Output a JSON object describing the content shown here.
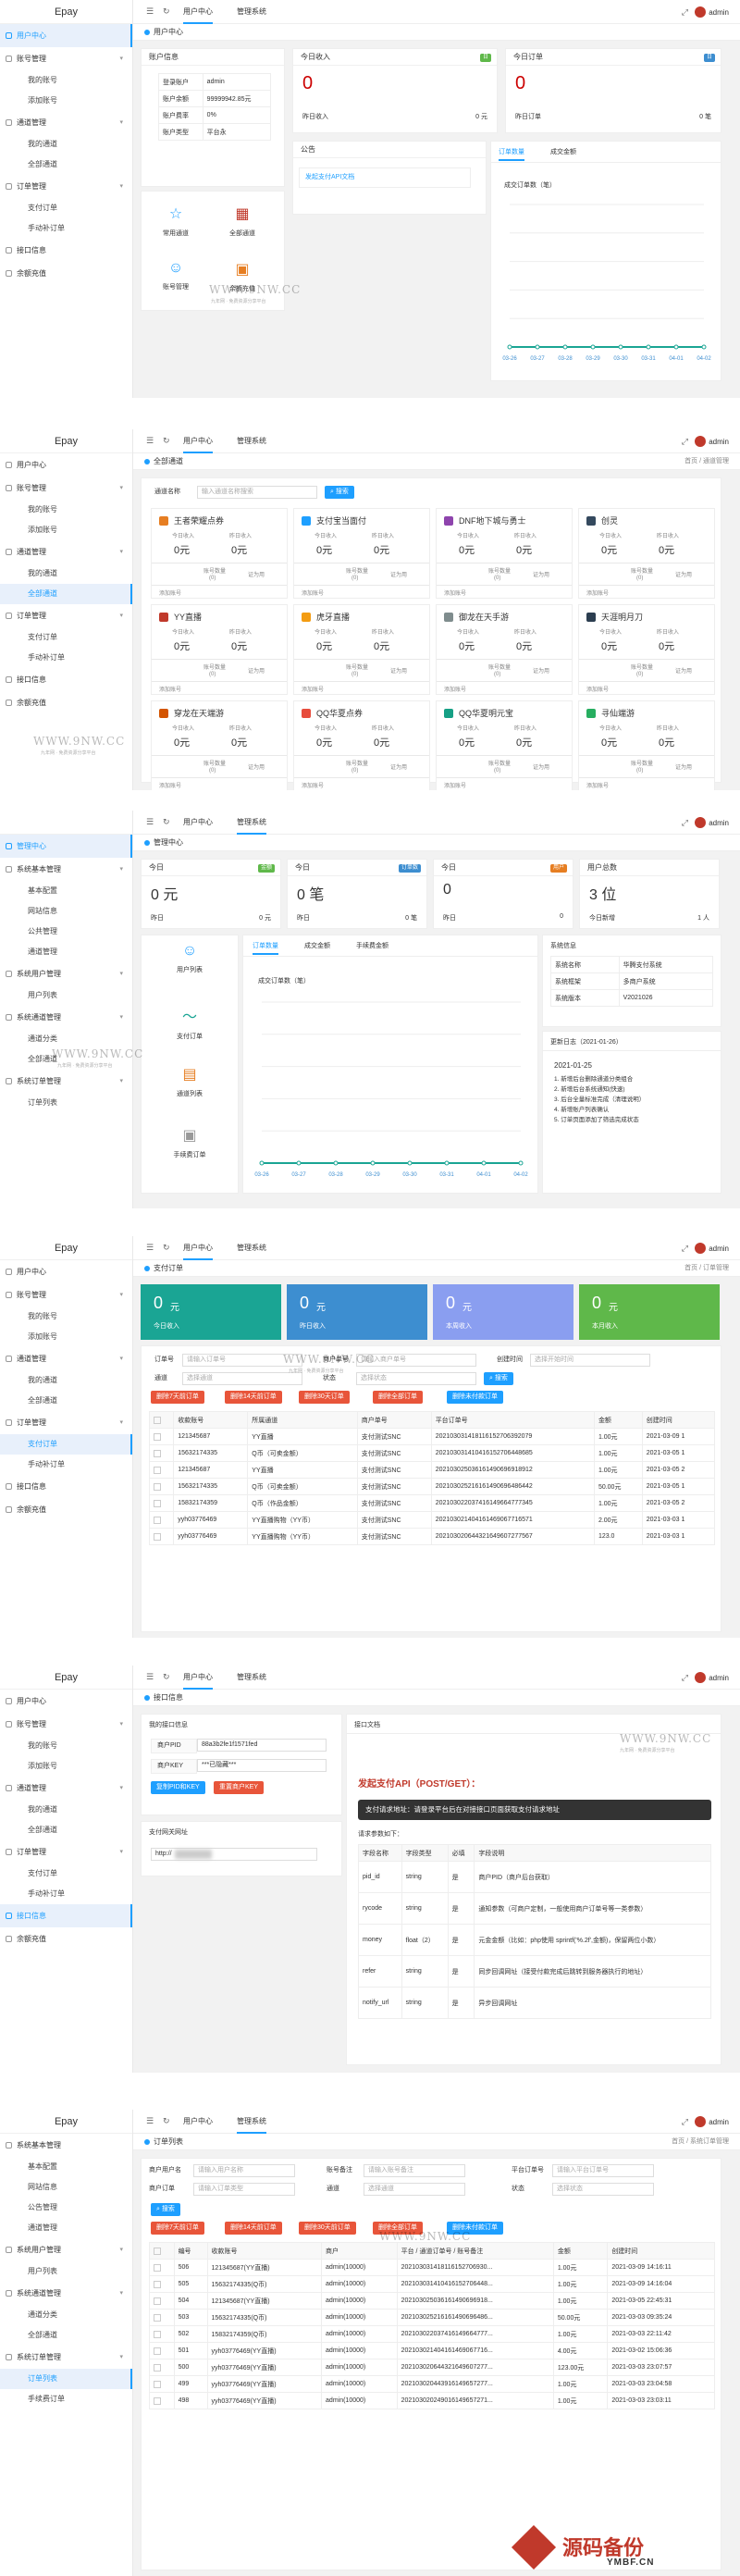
{
  "brand": "Epay",
  "top_nav": {
    "user_center": "用户中心",
    "admin_system": "管理系统",
    "user": "admin"
  },
  "watermark": {
    "text": "WWW.9NW.CC",
    "sub": "九年网 · 免费资源分享平台"
  },
  "corner_logo": {
    "title": "源码备份",
    "sub": "YMBF.CN"
  },
  "panel1": {
    "tab": "用户中心",
    "menu": [
      {
        "label": "用户中心",
        "active": true,
        "arrow": false
      },
      {
        "label": "账号管理",
        "active": false,
        "arrow": true,
        "subs": [
          "我的账号",
          "添加账号"
        ]
      },
      {
        "label": "通道管理",
        "active": false,
        "arrow": true,
        "subs": [
          "我的通道",
          "全部通道"
        ]
      },
      {
        "label": "订单管理",
        "active": false,
        "arrow": true,
        "subs": [
          "支付订单",
          "手动补订单"
        ]
      },
      {
        "label": "接口信息",
        "active": false,
        "arrow": false
      },
      {
        "label": "余额充值",
        "active": false,
        "arrow": false
      }
    ],
    "account": {
      "title": "账户信息",
      "rows": [
        [
          "登录账户",
          "admin"
        ],
        [
          "账户余额",
          "99999942.85元"
        ],
        [
          "账户费率",
          "0%"
        ],
        [
          "账户类型",
          "平台永"
        ]
      ]
    },
    "today_income": {
      "title": "今日收入",
      "badge": "日",
      "value": "0",
      "sub_left": "昨日收入",
      "sub_right": "0 元"
    },
    "today_orders": {
      "title": "今日订单",
      "badge": "日",
      "value": "0",
      "sub_left": "昨日订单",
      "sub_right": "0 笔"
    },
    "notice": {
      "title": "公告",
      "link": "发起支付API文档"
    },
    "chart_tabs": [
      "订单数量",
      "成交金额"
    ],
    "quick": [
      "常用通道",
      "全部通道",
      "账号管理",
      "余额充值"
    ],
    "chart_data": {
      "type": "line",
      "title": "成交订单数（笔）",
      "categories": [
        "03-26",
        "03-27",
        "03-28",
        "03-29",
        "03-30",
        "03-31",
        "04-01",
        "04-02"
      ],
      "values": [
        0,
        0,
        0,
        0,
        0,
        0,
        0,
        0
      ]
    }
  },
  "panel2": {
    "tab": "全部通道",
    "crumb": "首页 / 通道管理",
    "search_label": "通道名称",
    "search_placeholder": "输入通道名称搜索",
    "search_btn": "搜索",
    "channels": [
      "王者荣耀点券",
      "支付宝当面付",
      "DNF地下城与勇士",
      "创灵",
      "YY直播",
      "虎牙直播",
      "御龙在天手游",
      "天涯明月刀",
      "穿龙在天端游",
      "QQ华夏点券",
      "QQ华夏明元宝",
      "寻仙端游"
    ],
    "ch_labels": {
      "today": "今日收入",
      "yest": "昨日收入",
      "yuan": "0元",
      "accounts": "账号数量",
      "zero": "(0)",
      "add": "添加账号",
      "status": "证为用"
    }
  },
  "panel3": {
    "tab": "管理中心",
    "menu": [
      "管理中心",
      "系统基本管理",
      "基本配置",
      "网站信息",
      "公共管理",
      "通道管理",
      "系统用户管理",
      "用户列表",
      "系统通道管理",
      "通道分类",
      "全部通道",
      "系统订单管理",
      "订单列表"
    ],
    "cards": [
      {
        "title": "今日",
        "badge": "金额",
        "value": "0 元",
        "sub_left": "昨日",
        "sub_right": "0 元"
      },
      {
        "title": "今日",
        "badge": "订单数",
        "value": "0 笔",
        "sub_left": "昨日",
        "sub_right": "0 笔"
      },
      {
        "title": "今日",
        "badge": "用户",
        "value": "0",
        "sub_left": "昨日",
        "sub_right": "0"
      },
      {
        "title": "用户总数",
        "badge": "",
        "value": "3 位",
        "sub_left": "今日新增",
        "sub_right": "1 人"
      }
    ],
    "quick": [
      "用户列表",
      "支付订单",
      "通道列表",
      "手续费订单"
    ],
    "chart_tabs": [
      "订单数量",
      "成交金额",
      "手续费金额"
    ],
    "sysinfo": {
      "title": "系统信息",
      "rows": [
        [
          "系统名称",
          "华腾支付系统"
        ],
        [
          "系统框架",
          "多商户系统"
        ],
        [
          "系统版本",
          "V2021026"
        ]
      ]
    },
    "update": {
      "title": "更新日志（2021-01-26）",
      "date": "2021-01-25",
      "items": [
        "1. 新增后台删除通道分类组合",
        "2. 新增后台系统通知(快速)",
        "3. 后台全量标准完成（清理说明）",
        "4. 新增账户列表确认",
        "5. 订单页面添加了筛选完成状态"
      ]
    },
    "chart_data": {
      "type": "line",
      "title": "成交订单数（笔）",
      "categories": [
        "03-26",
        "03-27",
        "03-28",
        "03-29",
        "03-30",
        "03-31",
        "04-01",
        "04-02"
      ],
      "values": [
        0,
        0,
        0,
        0,
        0,
        0,
        0,
        0
      ]
    }
  },
  "panel4": {
    "tab": "支付订单",
    "crumb": "首页 / 订单管理",
    "stats": [
      [
        "0",
        "元",
        "今日收入",
        "#1aa594"
      ],
      [
        "0",
        "元",
        "昨日收入",
        "#3d8ed0"
      ],
      [
        "0",
        "元",
        "本周收入",
        "#8a9ef0"
      ],
      [
        "0",
        "元",
        "本月收入",
        "#5fb84a"
      ]
    ],
    "filter": {
      "order_no": "订单号",
      "order_ph": "请输入订单号",
      "pay_no": "商户单号",
      "pay_ph": "请输入商户单号",
      "channel": "通道",
      "channel_ph": "选择通道",
      "state": "状态",
      "state_ph": "选择状态",
      "date": "创建时间",
      "date_ph": "选择开始时间",
      "search": "搜索"
    },
    "actions": [
      "删除7天前订单",
      "删除14天前订单",
      "删除30天订单",
      "删除全部订单",
      "删除未付款订单"
    ],
    "columns": [
      "",
      "收款账号",
      "所属通道",
      "商户单号",
      "平台订单号",
      "金额",
      "创建时间"
    ],
    "rows": [
      [
        "121345687",
        "YY直播",
        "支付测试SNC",
        "202103031418116152706392079",
        "1.00元",
        "2021-03-09 1"
      ],
      [
        "15632174335",
        "Q币（可卖金额）",
        "支付测试SNC",
        "202103031410416152706448685",
        "1.00元",
        "2021-03-05 1"
      ],
      [
        "121345687",
        "YY直播",
        "支付测试SNC",
        "202103025036161490696918912",
        "1.00元",
        "2021-03-05 2"
      ],
      [
        "15632174335",
        "Q币（可卖金额）",
        "支付测试SNC",
        "202103025216161490696486442",
        "50.00元",
        "2021-03-05 1"
      ],
      [
        "15832174359",
        "Q币（作品金额）",
        "支付测试SNC",
        "202103022037416149664777345",
        "1.00元",
        "2021-03-05 2"
      ],
      [
        "yyh03776469",
        "YY直播购物（YY币）",
        "支付测试SNC",
        "202103021404161469067716571",
        "2.00元",
        "2021-03-03 1"
      ],
      [
        "yyh03776469",
        "YY直播购物（YY币）",
        "支付测试SNC",
        "202103020644321649607277567",
        "123.0",
        "2021-03-03 1"
      ]
    ]
  },
  "panel5": {
    "tab": "接口信息",
    "left_title": "我的接口信息",
    "pid_label": "商户PID",
    "pid": "88a3b2fe1f1571fed",
    "key_label": "商户KEY",
    "key": "***已隐藏***",
    "btn_copy": "复制PID和KEY",
    "btn_reset": "重置商户KEY",
    "gateway_title": "支付网关网址",
    "gateway": "http://",
    "doc_title": "接口文档",
    "api_title": "发起支付API（POST/GET）：",
    "api_desc": "支付请求地址：请登录平台后在对接接口页面获取支付请求地址",
    "params_title": "请求参数如下：",
    "columns": [
      "字段名称",
      "字段类型",
      "必填",
      "字段说明"
    ],
    "rows": [
      [
        "pid_id",
        "string",
        "是",
        "商户PID（商户后台获取）"
      ],
      [
        "rycode",
        "string",
        "是",
        "通知参数（可商户定制，一般使用商户订单号等一类参数）"
      ],
      [
        "money",
        "float（2）",
        "是",
        "元金金额（比如：php使用 sprintf('%.2f',金额)，保留两位小数）"
      ],
      [
        "refer",
        "string",
        "是",
        "同步回调网址（接受付款完成后跳转到服务器执行的地址）"
      ],
      [
        "notify_url",
        "string",
        "是",
        "异步回调网址"
      ]
    ]
  },
  "panel6": {
    "tab": "订单列表",
    "crumb": "首页 / 系统订单管理",
    "menu": [
      "系统基本管理",
      "基本配置",
      "网站信息",
      "公告管理",
      "通道管理",
      "系统用户管理",
      "用户列表",
      "系统通道管理",
      "通道分类",
      "全部通道",
      "系统订单管理",
      "订单列表",
      "手续费订单"
    ],
    "filter": {
      "user": "商户用户名",
      "user_ph": "请输入用户名称",
      "acc": "账号备注",
      "acc_ph": "请输入账号备注",
      "plat": "平台订单号",
      "plat_ph": "请输入平台订单号",
      "pay": "商户订单",
      "pay_ph": "请输入订单类型",
      "chan": "通道",
      "chan_ph": "选择通道",
      "state": "状态",
      "state_ph": "选择状态",
      "search": "搜索"
    },
    "actions": [
      "删除7天前订单",
      "删除14天前订单",
      "删除30天前订单",
      "删除全部订单",
      "删除未付款订单"
    ],
    "columns": [
      "",
      "编号",
      "收款账号",
      "商户",
      "平台 / 通道订单号 / 账号备注",
      "金额",
      "创建时间"
    ],
    "rows": [
      [
        "506",
        "121345687(YY直播)",
        "admin(10000)",
        "202103031418116152706930...",
        "1.00元",
        "2021-03-09 14:16:11"
      ],
      [
        "505",
        "15632174335(Q币)",
        "admin(10000)",
        "202103031410416152706448...",
        "1.00元",
        "2021-03-09 14:16:04"
      ],
      [
        "504",
        "121345687(YY直播)",
        "admin(10000)",
        "202103025036161490696918...",
        "1.00元",
        "2021-03-05 22:45:31"
      ],
      [
        "503",
        "15632174335(Q币)",
        "admin(10000)",
        "202103025216161490696486...",
        "50.00元",
        "2021-03-03 09:35:24"
      ],
      [
        "502",
        "15832174359(Q币)",
        "admin(10000)",
        "202103022037416149664777...",
        "1.00元",
        "2021-03-03 22:11:42"
      ],
      [
        "501",
        "yyh03776469(YY直播)",
        "admin(10000)",
        "202103021404161469067716...",
        "4.00元",
        "2021-03-02 15:06:36"
      ],
      [
        "500",
        "yyh03776469(YY直播)",
        "admin(10000)",
        "202103020644321649607277...",
        "123.00元",
        "2021-03-03 23:07:57"
      ],
      [
        "499",
        "yyh03776469(YY直播)",
        "admin(10000)",
        "202103020443916149657277...",
        "1.00元",
        "2021-03-03 23:04:58"
      ],
      [
        "498",
        "yyh03776469(YY直播)",
        "admin(10000)",
        "202103020249016149657271...",
        "1.00元",
        "2021-03-03 23:03:11"
      ]
    ]
  }
}
